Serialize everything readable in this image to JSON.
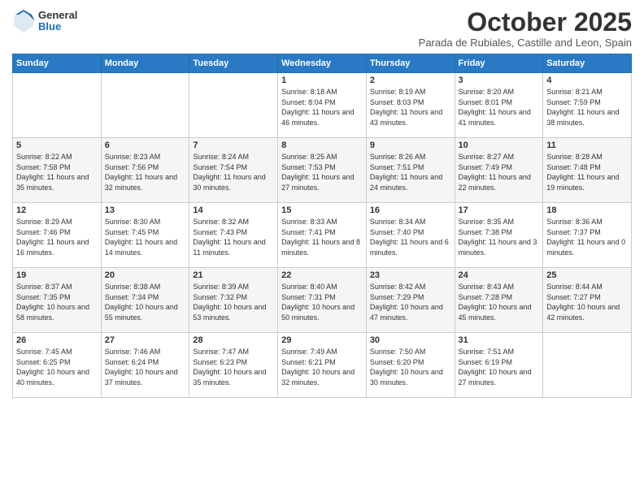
{
  "header": {
    "logo_general": "General",
    "logo_blue": "Blue",
    "month": "October 2025",
    "location": "Parada de Rubiales, Castille and Leon, Spain"
  },
  "days_of_week": [
    "Sunday",
    "Monday",
    "Tuesday",
    "Wednesday",
    "Thursday",
    "Friday",
    "Saturday"
  ],
  "weeks": [
    {
      "cells": [
        {
          "day": "",
          "content": ""
        },
        {
          "day": "",
          "content": ""
        },
        {
          "day": "",
          "content": ""
        },
        {
          "day": "1",
          "content": "Sunrise: 8:18 AM\nSunset: 8:04 PM\nDaylight: 11 hours and 46 minutes."
        },
        {
          "day": "2",
          "content": "Sunrise: 8:19 AM\nSunset: 8:03 PM\nDaylight: 11 hours and 43 minutes."
        },
        {
          "day": "3",
          "content": "Sunrise: 8:20 AM\nSunset: 8:01 PM\nDaylight: 11 hours and 41 minutes."
        },
        {
          "day": "4",
          "content": "Sunrise: 8:21 AM\nSunset: 7:59 PM\nDaylight: 11 hours and 38 minutes."
        }
      ]
    },
    {
      "cells": [
        {
          "day": "5",
          "content": "Sunrise: 8:22 AM\nSunset: 7:58 PM\nDaylight: 11 hours and 35 minutes."
        },
        {
          "day": "6",
          "content": "Sunrise: 8:23 AM\nSunset: 7:56 PM\nDaylight: 11 hours and 32 minutes."
        },
        {
          "day": "7",
          "content": "Sunrise: 8:24 AM\nSunset: 7:54 PM\nDaylight: 11 hours and 30 minutes."
        },
        {
          "day": "8",
          "content": "Sunrise: 8:25 AM\nSunset: 7:53 PM\nDaylight: 11 hours and 27 minutes."
        },
        {
          "day": "9",
          "content": "Sunrise: 8:26 AM\nSunset: 7:51 PM\nDaylight: 11 hours and 24 minutes."
        },
        {
          "day": "10",
          "content": "Sunrise: 8:27 AM\nSunset: 7:49 PM\nDaylight: 11 hours and 22 minutes."
        },
        {
          "day": "11",
          "content": "Sunrise: 8:28 AM\nSunset: 7:48 PM\nDaylight: 11 hours and 19 minutes."
        }
      ]
    },
    {
      "cells": [
        {
          "day": "12",
          "content": "Sunrise: 8:29 AM\nSunset: 7:46 PM\nDaylight: 11 hours and 16 minutes."
        },
        {
          "day": "13",
          "content": "Sunrise: 8:30 AM\nSunset: 7:45 PM\nDaylight: 11 hours and 14 minutes."
        },
        {
          "day": "14",
          "content": "Sunrise: 8:32 AM\nSunset: 7:43 PM\nDaylight: 11 hours and 11 minutes."
        },
        {
          "day": "15",
          "content": "Sunrise: 8:33 AM\nSunset: 7:41 PM\nDaylight: 11 hours and 8 minutes."
        },
        {
          "day": "16",
          "content": "Sunrise: 8:34 AM\nSunset: 7:40 PM\nDaylight: 11 hours and 6 minutes."
        },
        {
          "day": "17",
          "content": "Sunrise: 8:35 AM\nSunset: 7:38 PM\nDaylight: 11 hours and 3 minutes."
        },
        {
          "day": "18",
          "content": "Sunrise: 8:36 AM\nSunset: 7:37 PM\nDaylight: 11 hours and 0 minutes."
        }
      ]
    },
    {
      "cells": [
        {
          "day": "19",
          "content": "Sunrise: 8:37 AM\nSunset: 7:35 PM\nDaylight: 10 hours and 58 minutes."
        },
        {
          "day": "20",
          "content": "Sunrise: 8:38 AM\nSunset: 7:34 PM\nDaylight: 10 hours and 55 minutes."
        },
        {
          "day": "21",
          "content": "Sunrise: 8:39 AM\nSunset: 7:32 PM\nDaylight: 10 hours and 53 minutes."
        },
        {
          "day": "22",
          "content": "Sunrise: 8:40 AM\nSunset: 7:31 PM\nDaylight: 10 hours and 50 minutes."
        },
        {
          "day": "23",
          "content": "Sunrise: 8:42 AM\nSunset: 7:29 PM\nDaylight: 10 hours and 47 minutes."
        },
        {
          "day": "24",
          "content": "Sunrise: 8:43 AM\nSunset: 7:28 PM\nDaylight: 10 hours and 45 minutes."
        },
        {
          "day": "25",
          "content": "Sunrise: 8:44 AM\nSunset: 7:27 PM\nDaylight: 10 hours and 42 minutes."
        }
      ]
    },
    {
      "cells": [
        {
          "day": "26",
          "content": "Sunrise: 7:45 AM\nSunset: 6:25 PM\nDaylight: 10 hours and 40 minutes."
        },
        {
          "day": "27",
          "content": "Sunrise: 7:46 AM\nSunset: 6:24 PM\nDaylight: 10 hours and 37 minutes."
        },
        {
          "day": "28",
          "content": "Sunrise: 7:47 AM\nSunset: 6:23 PM\nDaylight: 10 hours and 35 minutes."
        },
        {
          "day": "29",
          "content": "Sunrise: 7:49 AM\nSunset: 6:21 PM\nDaylight: 10 hours and 32 minutes."
        },
        {
          "day": "30",
          "content": "Sunrise: 7:50 AM\nSunset: 6:20 PM\nDaylight: 10 hours and 30 minutes."
        },
        {
          "day": "31",
          "content": "Sunrise: 7:51 AM\nSunset: 6:19 PM\nDaylight: 10 hours and 27 minutes."
        },
        {
          "day": "",
          "content": ""
        }
      ]
    }
  ]
}
